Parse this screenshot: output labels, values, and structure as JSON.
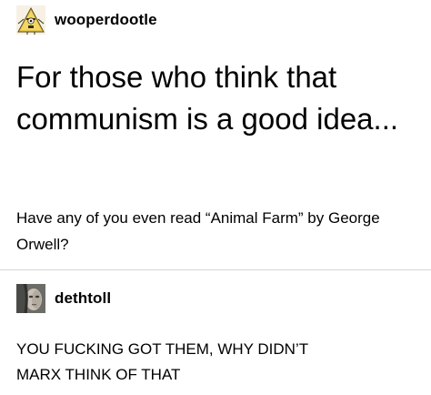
{
  "posts": [
    {
      "username": "wooperdootle",
      "avatar_icon": "triangle-cartoon-avatar",
      "headline": "For those who think that communism is a good idea...",
      "body": "Have any of you even read “Animal Farm” by George Orwell?"
    },
    {
      "username": "dethtoll",
      "avatar_icon": "photo-face-avatar",
      "body_line1": "YOU FUCKING GOT THEM, WHY DIDN’T",
      "body_line2": "MARX THINK OF THAT"
    }
  ]
}
